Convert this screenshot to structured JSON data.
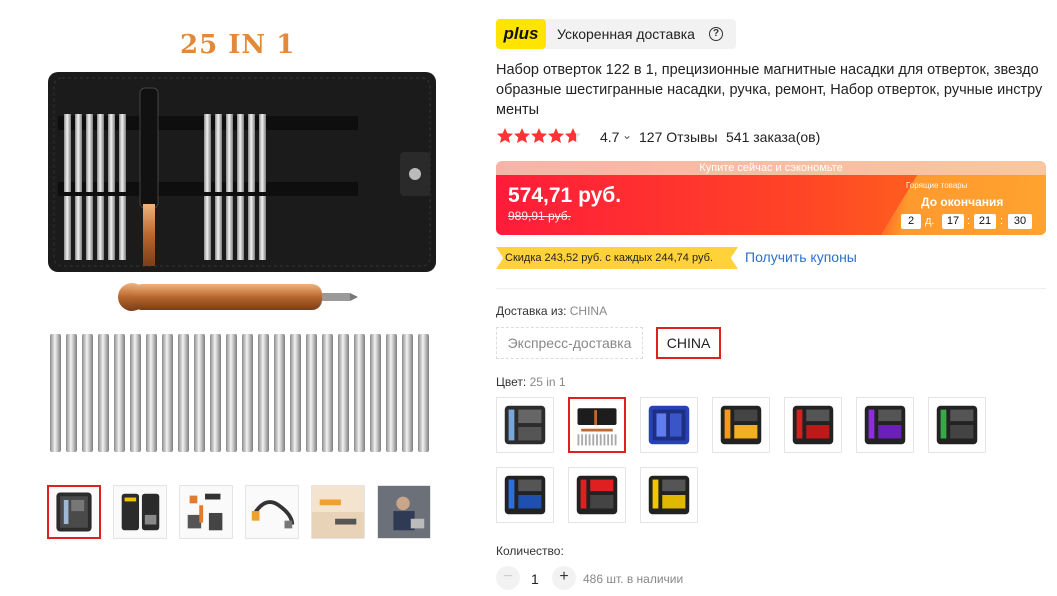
{
  "gallery": {
    "main_caption": "25 IN 1",
    "thumbnail_count": 6,
    "selected_index": 0
  },
  "badge": {
    "logo": "plus",
    "text": "Ускоренная доставка",
    "help_icon": "question-circle-icon"
  },
  "product": {
    "title": "Набор отверток 122 в 1, прецизионные магнитные насадки для отверток, звездообразные шестигранные насадки, ручка, ремонт, Набор отверток, ручные инструменты"
  },
  "rating": {
    "value": "4.7",
    "stars": 4.7,
    "reviews": "127 Отзывы",
    "orders": "541 заказа(ов)"
  },
  "price": {
    "promo": "Купите сейчас и сэкономьте",
    "current": "574,71 руб.",
    "old": "989,91 руб.",
    "deal_label": "Горящие товары",
    "ends_label": "До окончания",
    "countdown": {
      "days": "2",
      "days_unit": "д.",
      "hours": "17",
      "minutes": "21",
      "seconds": "30"
    }
  },
  "coupon": {
    "tag": "Скидка 243,52 руб. с каждых 244,74 руб.",
    "link": "Получить купоны"
  },
  "shipping": {
    "label": "Доставка из: ",
    "value": "CHINA",
    "options": [
      "Экспресс-доставка",
      "CHINA"
    ],
    "selected": "CHINA"
  },
  "color": {
    "label": "Цвет: ",
    "value": "25 in 1",
    "swatch_count": 10,
    "selected_index": 1
  },
  "quantity": {
    "label": "Количество:",
    "minus": "−",
    "value": "1",
    "plus": "+",
    "stock": "486 шт. в наличии"
  },
  "colors": {
    "accent_red": "#e02020",
    "price_red": "#ff1b3a",
    "plus_yellow": "#ffe400",
    "link_blue": "#2d6fd0"
  }
}
